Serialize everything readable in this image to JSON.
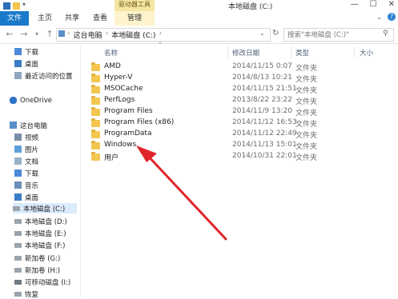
{
  "window": {
    "title": "本地磁盘 (C:)",
    "context_tab": "驱动器工具",
    "min": "—",
    "max": "☐",
    "close": "✕"
  },
  "ribbon": {
    "tabs": [
      "文件",
      "主页",
      "共享",
      "查看",
      "管理"
    ]
  },
  "address": {
    "back": "←",
    "forward": "→",
    "up": "↑",
    "crumbs": [
      "这台电脑",
      "本地磁盘 (C:)"
    ],
    "search_placeholder": "搜索\"本地磁盘 (C:)\""
  },
  "nav": {
    "quick": [
      "下载",
      "桌面",
      "最近访问的位置"
    ],
    "onedrive": "OneDrive",
    "pc": "这台电脑",
    "pc_items": [
      "视频",
      "图片",
      "文档",
      "下载",
      "音乐",
      "桌面",
      "本地磁盘 (C:)",
      "本地磁盘 (D:)",
      "本地磁盘 (E:)",
      "本地磁盘 (F:)",
      "新加卷 (G:)",
      "新加卷 (H:)",
      "可移动磁盘 (I:)",
      "恢复"
    ]
  },
  "columns": {
    "name": "名称",
    "date": "修改日期",
    "type": "类型",
    "size": "大小"
  },
  "files": [
    {
      "name": "AMD",
      "date": "2014/11/15 0:07",
      "type": "文件夹"
    },
    {
      "name": "Hyper-V",
      "date": "2014/8/13 10:21",
      "type": "文件夹"
    },
    {
      "name": "MSOCache",
      "date": "2014/11/15 21:51",
      "type": "文件夹"
    },
    {
      "name": "PerfLogs",
      "date": "2013/8/22 23:22",
      "type": "文件夹"
    },
    {
      "name": "Program Files",
      "date": "2014/11/9 13:20",
      "type": "文件夹"
    },
    {
      "name": "Program Files (x86)",
      "date": "2014/11/12 16:53",
      "type": "文件夹"
    },
    {
      "name": "ProgramData",
      "date": "2014/11/12 22:49",
      "type": "文件夹"
    },
    {
      "name": "Windows",
      "date": "2014/11/13 15:01",
      "type": "文件夹"
    },
    {
      "name": "用户",
      "date": "2014/10/31 22:01",
      "type": "文件夹"
    }
  ],
  "colors": {
    "file_tab": "#1979ca",
    "context_tab": "#f6e6a3",
    "folder": "#f3c64f",
    "annotation_arrow": "#e0252a",
    "selected_nav": "#dcebfc"
  }
}
